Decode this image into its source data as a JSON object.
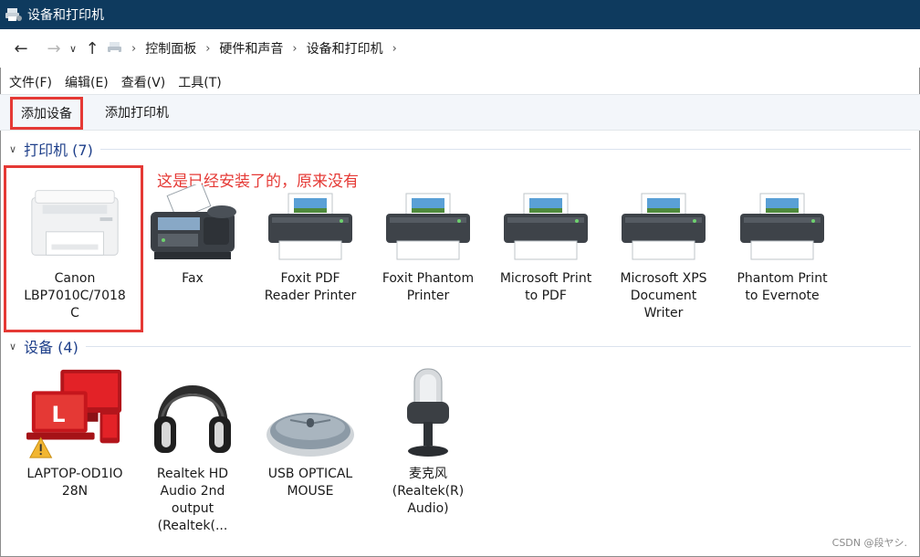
{
  "window": {
    "title": "设备和打印机"
  },
  "address": {
    "back_icon": "back-arrow-icon",
    "forward_icon": "forward-arrow-icon",
    "recent_icon": "chevron-down-icon",
    "up_icon": "up-arrow-icon",
    "breadcrumbs": [
      "控制面板",
      "硬件和声音",
      "设备和打印机"
    ]
  },
  "menu": {
    "items": [
      "文件(F)",
      "编辑(E)",
      "查看(V)",
      "工具(T)"
    ]
  },
  "commands": {
    "add_device": "添加设备",
    "add_printer": "添加打印机"
  },
  "printers": {
    "header": "打印机 (7)",
    "items": [
      {
        "label": "Canon\nLBP7010C/7018\nC",
        "icon": "canon-printer-icon"
      },
      {
        "label": "Fax",
        "icon": "fax-icon"
      },
      {
        "label": "Foxit PDF\nReader Printer",
        "icon": "printer-icon"
      },
      {
        "label": "Foxit Phantom\nPrinter",
        "icon": "printer-icon"
      },
      {
        "label": "Microsoft Print\nto PDF",
        "icon": "printer-icon"
      },
      {
        "label": "Microsoft XPS\nDocument\nWriter",
        "icon": "printer-icon"
      },
      {
        "label": "Phantom Print\nto Evernote",
        "icon": "printer-icon"
      }
    ]
  },
  "devices": {
    "header": "设备 (4)",
    "items": [
      {
        "label": "LAPTOP-OD1IO\n28N",
        "icon": "laptop-warning-icon"
      },
      {
        "label": "Realtek HD\nAudio 2nd\noutput\n(Realtek(...",
        "icon": "headphones-icon"
      },
      {
        "label": "USB OPTICAL\nMOUSE",
        "icon": "mouse-icon"
      },
      {
        "label": "麦克风\n(Realtek(R)\nAudio)",
        "icon": "microphone-icon"
      }
    ]
  },
  "annotation": "这是已经安装了的，原来没有",
  "watermark": "CSDN @段ヤシ.",
  "colors": {
    "title_bg": "#0e3a5e",
    "highlight": "#e53935",
    "group_header": "#1e3f8a"
  }
}
